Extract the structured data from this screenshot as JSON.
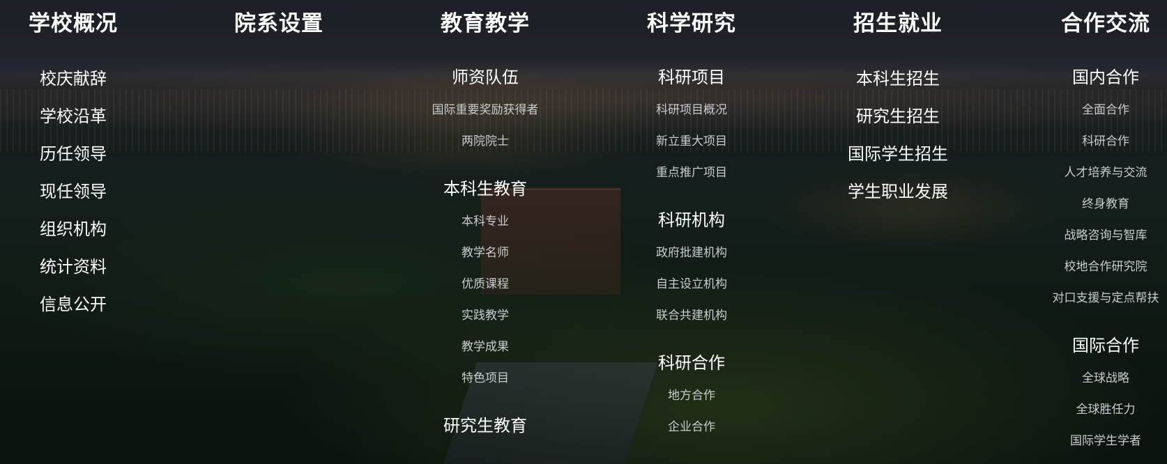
{
  "menu": {
    "columns": [
      {
        "title": "学校概况",
        "links": [
          "校庆献辞",
          "学校沿革",
          "历任领导",
          "现任领导",
          "组织机构",
          "统计资料",
          "信息公开"
        ]
      },
      {
        "title": "院系设置"
      },
      {
        "title": "教育教学",
        "groups": [
          {
            "title": "师资队伍",
            "items": [
              "国际重要奖励获得者",
              "两院院士"
            ]
          },
          {
            "title": "本科生教育",
            "items": [
              "本科专业",
              "教学名师",
              "优质课程",
              "实践教学",
              "教学成果",
              "特色项目"
            ]
          },
          {
            "title": "研究生教育",
            "items": []
          }
        ]
      },
      {
        "title": "科学研究",
        "groups": [
          {
            "title": "科研项目",
            "items": [
              "科研项目概况",
              "新立重大项目",
              "重点推广项目"
            ]
          },
          {
            "title": "科研机构",
            "items": [
              "政府批建机构",
              "自主设立机构",
              "联合共建机构"
            ]
          },
          {
            "title": "科研合作",
            "items": [
              "地方合作",
              "企业合作"
            ]
          }
        ]
      },
      {
        "title": "招生就业",
        "links": [
          "本科生招生",
          "研究生招生",
          "国际学生招生",
          "学生职业发展"
        ]
      },
      {
        "title": "合作交流",
        "groups": [
          {
            "title": "国内合作",
            "items": [
              "全面合作",
              "科研合作",
              "人才培养与交流",
              "终身教育",
              "战略咨询与智库",
              "校地合作研究院",
              "对口支援与定点帮扶"
            ]
          },
          {
            "title": "国际合作",
            "items": [
              "全球战略",
              "全球胜任力",
              "国际学生学者"
            ]
          }
        ]
      }
    ]
  }
}
